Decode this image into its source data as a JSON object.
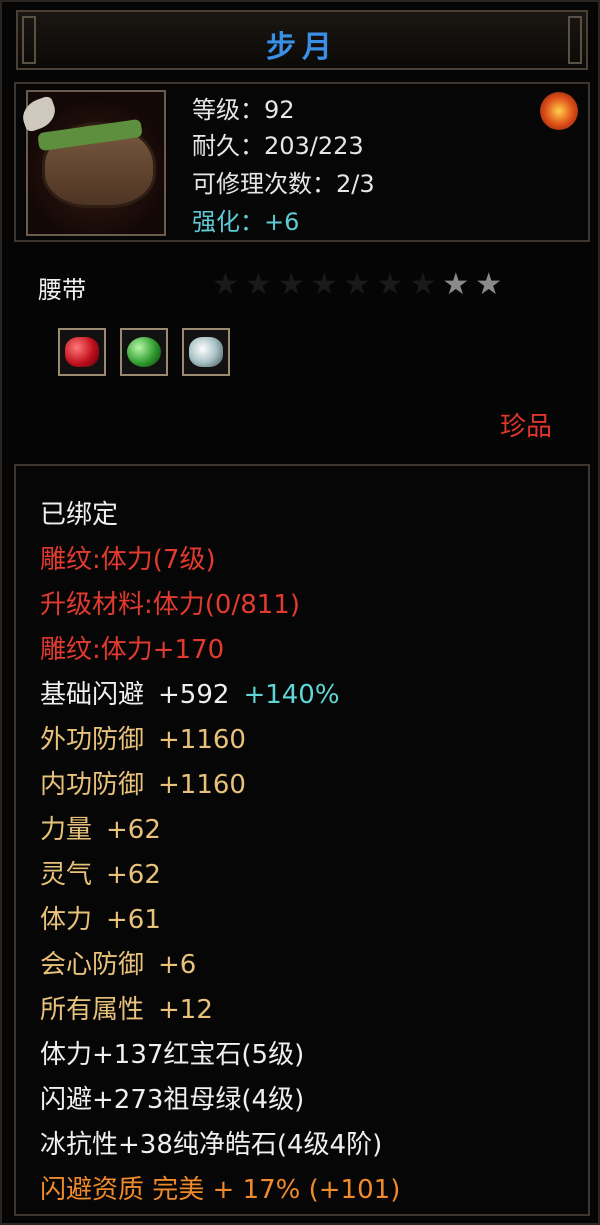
{
  "title": "步月",
  "item": {
    "level_label": "等级：92",
    "durability_label": "耐久：203/223",
    "repair_label": "可修理次数：2/3",
    "enhance_label": "强化：+6",
    "slot_name": "腰带",
    "stars_total": 9,
    "stars_filled": 2,
    "gems": [
      "red-gem-icon",
      "green-jade-icon",
      "white-diamond-icon"
    ],
    "rarity": "珍品"
  },
  "attributes": {
    "bound": "已绑定",
    "engrave1": "雕纹:体力(7级)",
    "upgrade_material": "升级材料:体力(0/811)",
    "engrave2": "雕纹:体力+170",
    "dodge_name": "基础闪避",
    "dodge_value": "+592",
    "dodge_bonus": "+140%",
    "ext_def_name": "外功防御",
    "ext_def_value": "+1160",
    "int_def_name": "内功防御",
    "int_def_value": "+1160",
    "str_name": "力量",
    "str_value": "+62",
    "spirit_name": "灵气",
    "spirit_value": "+62",
    "vit_name": "体力",
    "vit_value": "+61",
    "crit_def_name": "会心防御",
    "crit_def_value": "+6",
    "all_attr_name": "所有属性",
    "all_attr_value": "+12",
    "gem1": "体力+137红宝石(5级)",
    "gem2": "闪避+273祖母绿(4级)",
    "gem3": "冰抗性+38纯净皓石(4级4阶)",
    "quality": "闪避资质 完美 + 17% (+101)"
  },
  "colors": {
    "title": "#3a8fe6",
    "red": "#e23a2e",
    "gold": "#e8c17a",
    "cyan": "#5fd6d6",
    "orange": "#f08a2a"
  }
}
